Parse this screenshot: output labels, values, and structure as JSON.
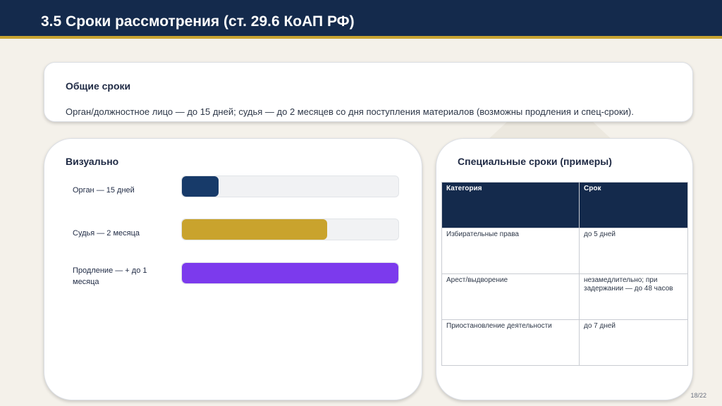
{
  "header": {
    "title": "3.5 Сроки рассмотрения (ст. 29.6 КоАП РФ)"
  },
  "general": {
    "heading": "Общие сроки",
    "text": "Орган/должностное лицо — до 15 дней; судья — до 2 месяцев со дня поступления материалов (возможны продления и спец-сроки)."
  },
  "visual": {
    "heading": "Визуально",
    "bars": [
      {
        "label": "Орган — 15 дней",
        "fraction": 0.17,
        "color": "#173a69"
      },
      {
        "label": "Судья — 2 месяца",
        "fraction": 0.67,
        "color": "#c9a32d"
      },
      {
        "label": "Продление — + до 1 месяца",
        "fraction": 1.0,
        "color": "#7c3aed"
      }
    ]
  },
  "special": {
    "heading": "Специальные сроки (примеры)",
    "columns": [
      "Категория",
      "Срок"
    ],
    "rows": [
      [
        "Избирательные права",
        "до 5 дней"
      ],
      [
        "Арест/выдворение",
        "незамедлительно; при задержании — до 48 часов"
      ],
      [
        "Приостановление деятельности",
        "до 7 дней"
      ]
    ]
  },
  "footer": {
    "page": "18/22"
  },
  "colors": {
    "navy": "#142a4c",
    "gold": "#c9a431",
    "background": "#f4f1ea"
  }
}
